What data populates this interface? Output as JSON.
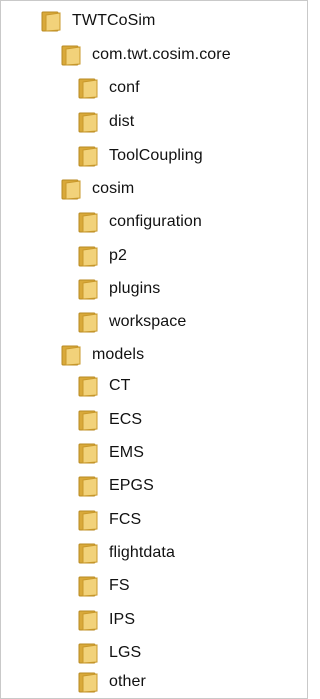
{
  "folder_tree": {
    "items": [
      {
        "label": "TWTCoSim",
        "icon": "folder-icon"
      },
      {
        "label": "com.twt.cosim.core",
        "icon": "folder-icon"
      },
      {
        "label": "conf",
        "icon": "folder-icon"
      },
      {
        "label": "dist",
        "icon": "folder-icon"
      },
      {
        "label": "ToolCoupling",
        "icon": "folder-icon"
      },
      {
        "label": "cosim",
        "icon": "folder-icon"
      },
      {
        "label": "configuration",
        "icon": "folder-icon"
      },
      {
        "label": "p2",
        "icon": "folder-icon"
      },
      {
        "label": "plugins",
        "icon": "folder-icon"
      },
      {
        "label": "workspace",
        "icon": "folder-icon"
      },
      {
        "label": "models",
        "icon": "folder-icon"
      },
      {
        "label": "CT",
        "icon": "folder-icon"
      },
      {
        "label": "ECS",
        "icon": "folder-icon"
      },
      {
        "label": "EMS",
        "icon": "folder-icon"
      },
      {
        "label": "EPGS",
        "icon": "folder-icon"
      },
      {
        "label": "FCS",
        "icon": "folder-icon"
      },
      {
        "label": "flightdata",
        "icon": "folder-icon"
      },
      {
        "label": "FS",
        "icon": "folder-icon"
      },
      {
        "label": "IPS",
        "icon": "folder-icon"
      },
      {
        "label": "LGS",
        "icon": "folder-icon"
      },
      {
        "label": "other",
        "icon": "folder-icon"
      }
    ]
  },
  "colors": {
    "folder_back": "#d9a93a",
    "folder_front": "#f2d27a",
    "folder_edge": "#b88a22",
    "text": "#111111"
  }
}
